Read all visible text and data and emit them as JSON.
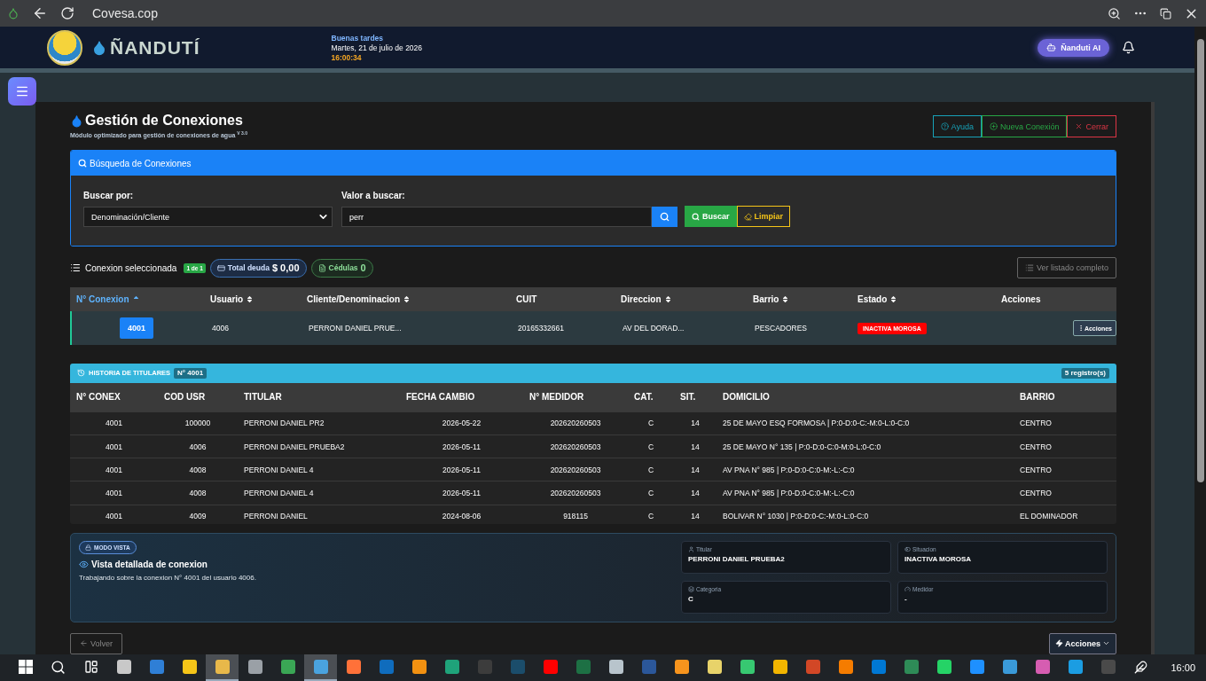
{
  "browser": {
    "url": "Covesa.cop"
  },
  "header": {
    "brand": "ÑANDUTÍ",
    "greeting": "Buenas tardes",
    "date": "Martes, 21 de julio de 2026",
    "time": "16:00:34",
    "ai_button": "Ñanduti AI"
  },
  "page": {
    "title": "Gestión de Conexiones",
    "subtitle": "Módulo optimizado para gestión de conexiones de agua $^{V 3.0}$",
    "buttons": [
      {
        "kind": "help",
        "label": "Ayuda"
      },
      {
        "kind": "new",
        "label": "Nueva Conexión"
      },
      {
        "kind": "close",
        "label": "Cerrar"
      }
    ]
  },
  "search": {
    "title": "Búsqueda de Conexiones",
    "by_label": "Buscar por:",
    "by_value": "Denominación/Cliente",
    "value_label": "Valor a buscar:",
    "value": "perr",
    "search_button": "Buscar",
    "clear_button": "Limpiar"
  },
  "summary": {
    "title": "Conexion seleccionada",
    "count": "1 de 1",
    "debt_label": "Total deuda",
    "debt": "$ 0,00",
    "cedulas_label": "Cédulas",
    "cedulas": "0",
    "full_list_button": "Ver listado completo"
  },
  "table": {
    "columns": [
      {
        "label": "N° Conexion",
        "sortable": true,
        "sorted": true
      },
      {
        "label": "Usuario",
        "sortable": true,
        "sorted": false
      },
      {
        "label": "Cliente/Denominacion",
        "sortable": true,
        "sorted": false
      },
      {
        "label": "CUIT",
        "sortable": false,
        "sorted": false
      },
      {
        "label": "Direccion",
        "sortable": true,
        "sorted": false
      },
      {
        "label": "Barrio",
        "sortable": true,
        "sorted": false
      },
      {
        "label": "Estado",
        "sortable": true,
        "sorted": false
      },
      {
        "label": "Acciones",
        "sortable": false,
        "sorted": false
      }
    ],
    "rows": [
      {
        "selected": true,
        "conexion": "4001",
        "usuario": "4006",
        "cliente": "PERRONI DANIEL PRUE...",
        "cuit": "20165332661",
        "direccion": "AV DEL DORAD...",
        "barrio": "PESCADORES",
        "estado": {
          "text": "INACTIVA MOROSA",
          "color": "#ff0000"
        },
        "acciones": "Acciones"
      }
    ]
  },
  "history": {
    "title": "HISTORIA DE TITULARES",
    "badge": "N° 4001",
    "count": "5 registro(s)",
    "columns": [
      "N° CONEX",
      "COD USR",
      "TITULAR",
      "FECHA CAMBIO",
      "N° MEDIDOR",
      "CAT.",
      "SIT.",
      "DOMICILIO",
      "BARRIO"
    ],
    "rows": [
      [
        "4001",
        "100000",
        "PERRONI DANIEL PR2",
        "2026-05-22",
        "202620260503",
        "C",
        "14",
        "25 DE MAYO ESQ FORMOSA | P:0-D:0-C:-M:0-L:0-C:0",
        "CENTRO"
      ],
      [
        "4001",
        "4006",
        "PERRONI DANIEL PRUEBA2",
        "2026-05-11",
        "202620260503",
        "C",
        "14",
        "25 DE MAYO N° 135 | P:0-D:0-C:0-M:0-L:0-C:0",
        "CENTRO"
      ],
      [
        "4001",
        "4008",
        "PERRONI DANIEL 4",
        "2026-05-11",
        "202620260503",
        "C",
        "14",
        "AV PNA N° 985 | P:0-D:0-C:0-M:-L:-C:0",
        "CENTRO"
      ],
      [
        "4001",
        "4008",
        "PERRONI DANIEL 4",
        "2026-05-11",
        "202620260503",
        "C",
        "14",
        "AV PNA N° 985 | P:0-D:0-C:0-M:-L:-C:0",
        "CENTRO"
      ],
      [
        "4001",
        "4009",
        "PERRONI DANIEL",
        "2024-08-06",
        "918115",
        "C",
        "14",
        "BOLIVAR N° 1030 | P:0-D:0-C:-M:0-L:0-C:0",
        "EL DOMINADOR"
      ]
    ]
  },
  "detail": {
    "mode": "MODO VISTA",
    "title": "Vista detallada de conexion",
    "text": "Trabajando sobre la conexion N° 4001 del usuario 4006.",
    "fields": [
      {
        "kind": "user",
        "label": "Titular",
        "value": "PERRONI DANIEL PRUEBA2"
      },
      {
        "kind": "status",
        "label": "Situacion",
        "value": "INACTIVA MOROSA"
      },
      {
        "kind": "category",
        "label": "Categoria",
        "value": "C"
      },
      {
        "kind": "meter",
        "label": "Medidor",
        "value": "-"
      }
    ]
  },
  "footer": {
    "back": "Volver",
    "actions": "Acciones"
  },
  "taskbar": {
    "time": "16:00",
    "apps": [
      {
        "selected": false,
        "color": "#c8c8c8"
      },
      {
        "selected": false,
        "color": "#2f7fd6"
      },
      {
        "selected": false,
        "color": "#f5c518"
      },
      {
        "selected": true,
        "color": "#e8b84a"
      },
      {
        "selected": false,
        "color": "#9aa0a6"
      },
      {
        "selected": false,
        "color": "#3aa655"
      },
      {
        "selected": true,
        "color": "#4aa3df"
      },
      {
        "selected": false,
        "color": "#ff7139"
      },
      {
        "selected": false,
        "color": "#0f6cbd"
      },
      {
        "selected": false,
        "color": "#f29111"
      },
      {
        "selected": false,
        "color": "#1fa37a"
      },
      {
        "selected": false,
        "color": "#3c3c3c"
      },
      {
        "selected": false,
        "color": "#1b4d6b"
      },
      {
        "selected": false,
        "color": "#ff0000"
      },
      {
        "selected": false,
        "color": "#1d7044"
      },
      {
        "selected": false,
        "color": "#b8c4cc"
      },
      {
        "selected": false,
        "color": "#2b579a"
      },
      {
        "selected": false,
        "color": "#f7941d"
      },
      {
        "selected": false,
        "color": "#e8d36a"
      },
      {
        "selected": false,
        "color": "#37c871"
      },
      {
        "selected": false,
        "color": "#f2b500"
      },
      {
        "selected": false,
        "color": "#d24726"
      },
      {
        "selected": false,
        "color": "#f57c00"
      },
      {
        "selected": false,
        "color": "#0078d4"
      },
      {
        "selected": false,
        "color": "#2e8b57"
      },
      {
        "selected": false,
        "color": "#25d366"
      },
      {
        "selected": false,
        "color": "#1e90ff"
      },
      {
        "selected": false,
        "color": "#3a9ad9"
      },
      {
        "selected": false,
        "color": "#d65db1"
      },
      {
        "selected": false,
        "color": "#1b9de2"
      },
      {
        "selected": false,
        "color": "#4a4a4a"
      }
    ]
  }
}
